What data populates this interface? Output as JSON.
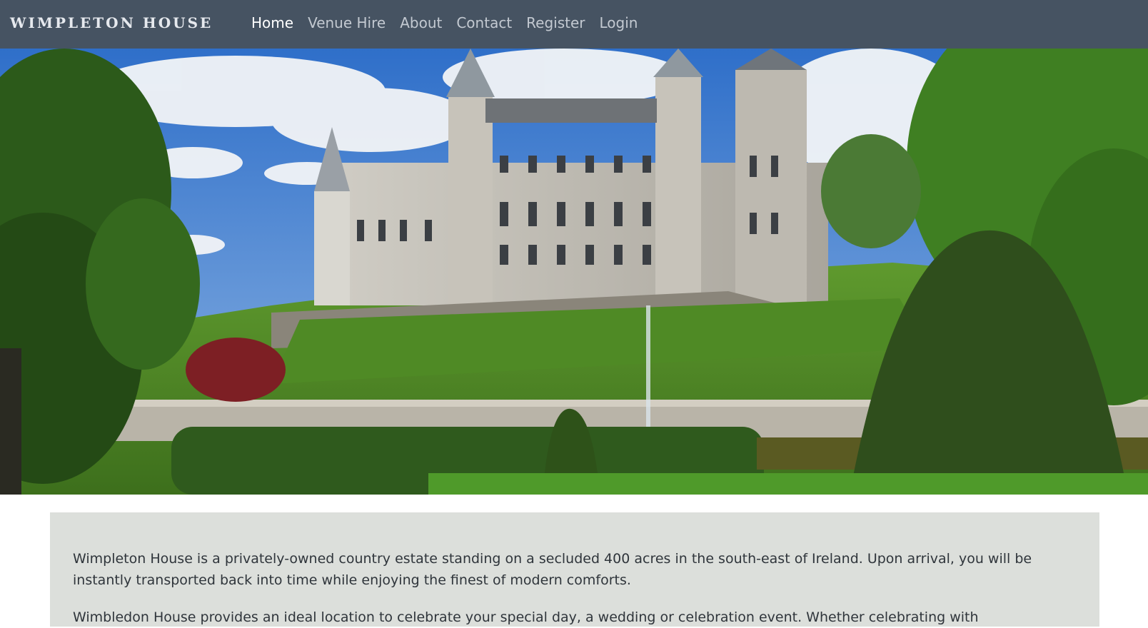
{
  "brand": {
    "name": "WIMPLETON HOUSE"
  },
  "nav": {
    "items": [
      {
        "label": "Home",
        "active": true
      },
      {
        "label": "Venue Hire",
        "active": false
      },
      {
        "label": "About",
        "active": false
      },
      {
        "label": "Contact",
        "active": false
      },
      {
        "label": "Register",
        "active": false
      },
      {
        "label": "Login",
        "active": false
      }
    ]
  },
  "hero": {
    "alt": "Wimpleton House castle estate with formal gardens"
  },
  "intro": {
    "paragraph_1": "Wimpleton House is a privately-owned country estate standing on a secluded 400 acres in the south-east of Ireland. Upon arrival, you will be instantly transported back into time while enjoying the finest of modern comforts.",
    "paragraph_2_partial": "Wimbledon House provides an ideal location to celebrate your special day, a wedding or celebration event. Whether celebrating with"
  },
  "colors": {
    "navbar_bg": "#465362",
    "active_link": "#ffffff",
    "inactive_link": "#c3c9d1",
    "card_bg": "#dcdfdb",
    "body_text": "#2f353b"
  }
}
